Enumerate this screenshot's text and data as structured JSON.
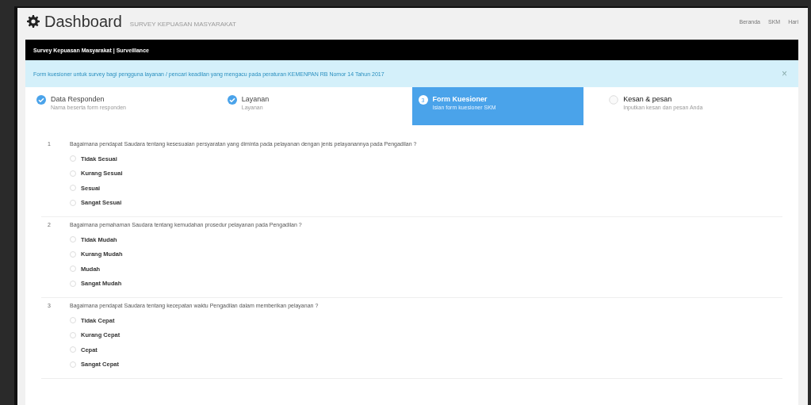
{
  "header": {
    "title": "Dashboard",
    "subtitle": "SURVEY KEPUASAN MASYARAKAT",
    "nav": [
      "Beranda",
      "SKM",
      "Hari"
    ]
  },
  "panel": {
    "title": "Survey Kepuasan Masyarakat | Surveillance"
  },
  "alert": {
    "text": "Form kuesioner untuk survey bagi pengguna layanan / pencari keadilan yang mengacu pada peraturan KEMENPAN RB Nomor 14 Tahun 2017",
    "close": "×"
  },
  "steps": [
    {
      "title": "Data Responden",
      "subtitle": "Nama beserta form responden",
      "completed": true,
      "selected": false
    },
    {
      "title": "Layanan",
      "subtitle": "Layanan",
      "completed": true,
      "selected": false
    },
    {
      "number": "3",
      "title": "Form Kuesioner",
      "subtitle": "Isian form kuesioner SKM",
      "selected": true
    },
    {
      "title": "Kesan & pesan",
      "subtitle": "Inputkan kesan dan pesan Anda",
      "completed": false,
      "selected": false
    }
  ],
  "questions": [
    {
      "number": "1",
      "text": "Bagaimana pendapat Saudara tentang kesesuaian persyaratan yang diminta pada pelayanan dengan jenis pelayanannya pada Pengadilan ?",
      "options": [
        {
          "label": "Tidak Sesuai",
          "selected": false
        },
        {
          "label": "Kurang Sesuai",
          "selected": false
        },
        {
          "label": "Sesuai",
          "selected": false
        },
        {
          "label": "Sangat Sesuai",
          "selected": false
        }
      ]
    },
    {
      "number": "2",
      "text": "Bagaimana pemahaman Saudara tentang kemudahan prosedur pelayanan pada Pengadilan ?",
      "options": [
        {
          "label": "Tidak Mudah",
          "selected": false
        },
        {
          "label": "Kurang Mudah",
          "selected": false
        },
        {
          "label": "Mudah",
          "selected": false
        },
        {
          "label": "Sangat Mudah",
          "selected": false
        }
      ]
    },
    {
      "number": "3",
      "text": "Bagaimana pendapat Saudara tentang kecepatan waktu Pengadilan dalam memberikan pelayanan ?",
      "options": [
        {
          "label": "Tidak Cepat",
          "selected": false
        },
        {
          "label": "Kurang Cepat",
          "selected": false
        },
        {
          "label": "Cepat",
          "selected": false
        },
        {
          "label": "Sangat Cepat",
          "selected": false
        }
      ]
    }
  ]
}
